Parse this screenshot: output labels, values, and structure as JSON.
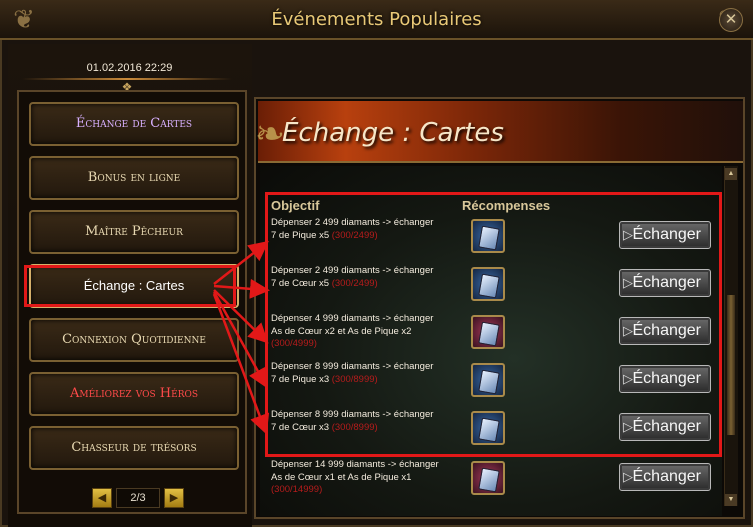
{
  "window": {
    "title": "Événements Populaires",
    "close_icon": "close-icon"
  },
  "datetime": "01.02.2016 22:29",
  "menu": {
    "items": [
      {
        "label": "Échange de Cartes",
        "state": "active"
      },
      {
        "label": "Bonus en ligne",
        "state": "normal"
      },
      {
        "label": "Maître Pêcheur",
        "state": "normal"
      },
      {
        "label": "Échange : Cartes",
        "state": "current"
      },
      {
        "label": "Connexion Quotidienne",
        "state": "normal"
      },
      {
        "label": "Améliorez vos Héros",
        "state": "highlight"
      },
      {
        "label": "Chasseur de trésors",
        "state": "normal"
      }
    ],
    "pager": {
      "text": "2/3"
    }
  },
  "banner": {
    "title": "Échange : Cartes"
  },
  "table": {
    "col_objectif": "Objectif",
    "col_recompenses": "Récompenses",
    "exchange_label": "Échanger",
    "rows": [
      {
        "objective": "Dépenser 2 499 diamants -> échanger 7 de Pique x5",
        "progress": "(300/2499)",
        "icon_color": "#3a6aa6"
      },
      {
        "objective": "Dépenser 2 499 diamants -> échanger 7 de Cœur x5",
        "progress": "(300/2499)",
        "icon_color": "#3a6aa6"
      },
      {
        "objective": "Dépenser 4 999 diamants -> échanger As de Cœur x2 et As de Pique x2",
        "progress": "(300/4999)",
        "icon_color": "#a63a5a"
      },
      {
        "objective": "Dépenser 8 999 diamants -> échanger 7 de Pique x3",
        "progress": "(300/8999)",
        "icon_color": "#3a6aa6"
      },
      {
        "objective": "Dépenser 8 999 diamants -> échanger 7 de Cœur x3",
        "progress": "(300/8999)",
        "icon_color": "#3a6aa6"
      },
      {
        "objective": "Dépenser 14 999 diamants -> échanger As de Cœur x1 et As de Pique x1",
        "progress": "(300/14999)",
        "icon_color": "#a63a5a"
      }
    ]
  },
  "colors": {
    "accent_gold": "#e9c977",
    "annotation_red": "#e21818",
    "progress_red": "#b51c1c"
  }
}
